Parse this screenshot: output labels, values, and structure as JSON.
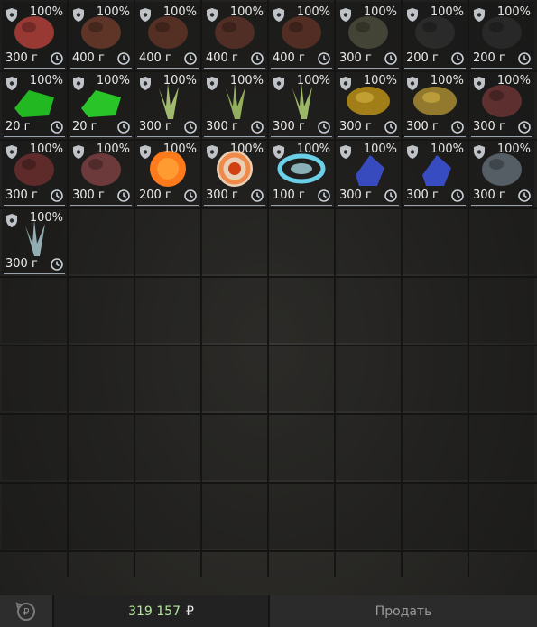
{
  "slots": [
    {
      "pct": "100%",
      "amount": "300 г",
      "icon": "red-fungus-artifact-icon",
      "color": "#b0403a"
    },
    {
      "pct": "100%",
      "amount": "400 г",
      "icon": "dark-red-root-artifact-icon",
      "color": "#6a3a2a"
    },
    {
      "pct": "100%",
      "amount": "400 г",
      "icon": "dark-red-root-artifact-icon",
      "color": "#5e3326"
    },
    {
      "pct": "100%",
      "amount": "400 г",
      "icon": "dark-red-root-artifact-icon",
      "color": "#5b3127"
    },
    {
      "pct": "100%",
      "amount": "400 г",
      "icon": "dark-red-root-artifact-icon",
      "color": "#5a3024"
    },
    {
      "pct": "100%",
      "amount": "300 г",
      "icon": "black-pebble-artifact-icon",
      "color": "#4b4b3c"
    },
    {
      "pct": "100%",
      "amount": "200 г",
      "icon": "black-rock-artifact-icon",
      "color": "#2e2e2e"
    },
    {
      "pct": "100%",
      "amount": "200 г",
      "icon": "black-rock-artifact-icon",
      "color": "#2b2b2b"
    },
    {
      "pct": "100%",
      "amount": "20 г",
      "icon": "green-crystal-artifact-icon",
      "color": "#22b822"
    },
    {
      "pct": "100%",
      "amount": "20 г",
      "icon": "green-crystal-artifact-icon",
      "color": "#28c428"
    },
    {
      "pct": "100%",
      "amount": "300 г",
      "icon": "green-sprout-artifact-icon",
      "color": "#b9d67c"
    },
    {
      "pct": "100%",
      "amount": "300 г",
      "icon": "green-sprout-artifact-icon",
      "color": "#a9c86c"
    },
    {
      "pct": "100%",
      "amount": "300 г",
      "icon": "green-sprout-artifact-icon",
      "color": "#b4d277"
    },
    {
      "pct": "100%",
      "amount": "300 г",
      "icon": "gold-lump-artifact-icon",
      "color": "#b08a18"
    },
    {
      "pct": "100%",
      "amount": "300 г",
      "icon": "gold-swirl-artifact-icon",
      "color": "#a08430"
    },
    {
      "pct": "100%",
      "amount": "300 г",
      "icon": "dark-red-stone-artifact-icon",
      "color": "#6a3434"
    },
    {
      "pct": "100%",
      "amount": "300 г",
      "icon": "dark-red-clump-artifact-icon",
      "color": "#6a2e2e"
    },
    {
      "pct": "100%",
      "amount": "300 г",
      "icon": "dark-red-ball-artifact-icon",
      "color": "#7a4040"
    },
    {
      "pct": "100%",
      "amount": "200 г",
      "icon": "fireball-artifact-icon",
      "color": "#ff7a1a"
    },
    {
      "pct": "100%",
      "amount": "300 г",
      "icon": "fire-spiral-artifact-icon",
      "color": "#f08a4a"
    },
    {
      "pct": "100%",
      "amount": "100 г",
      "icon": "blue-vortex-artifact-icon",
      "color": "#6ad0e8"
    },
    {
      "pct": "100%",
      "amount": "300 г",
      "icon": "blue-crystal-artifact-icon",
      "color": "#3a50d0"
    },
    {
      "pct": "100%",
      "amount": "300 г",
      "icon": "blue-crystal-artifact-icon",
      "color": "#3c52d4"
    },
    {
      "pct": "100%",
      "amount": "300 г",
      "icon": "dark-gray-shard-artifact-icon",
      "color": "#5e6a72"
    },
    {
      "pct": "100%",
      "amount": "300 г",
      "icon": "pale-crystal-artifact-icon",
      "color": "#a8c8cc"
    }
  ],
  "footer": {
    "refresh_icon": "ruble-refresh-icon",
    "balance": "319 157",
    "currency": "₽",
    "sell_label": "Продать"
  }
}
